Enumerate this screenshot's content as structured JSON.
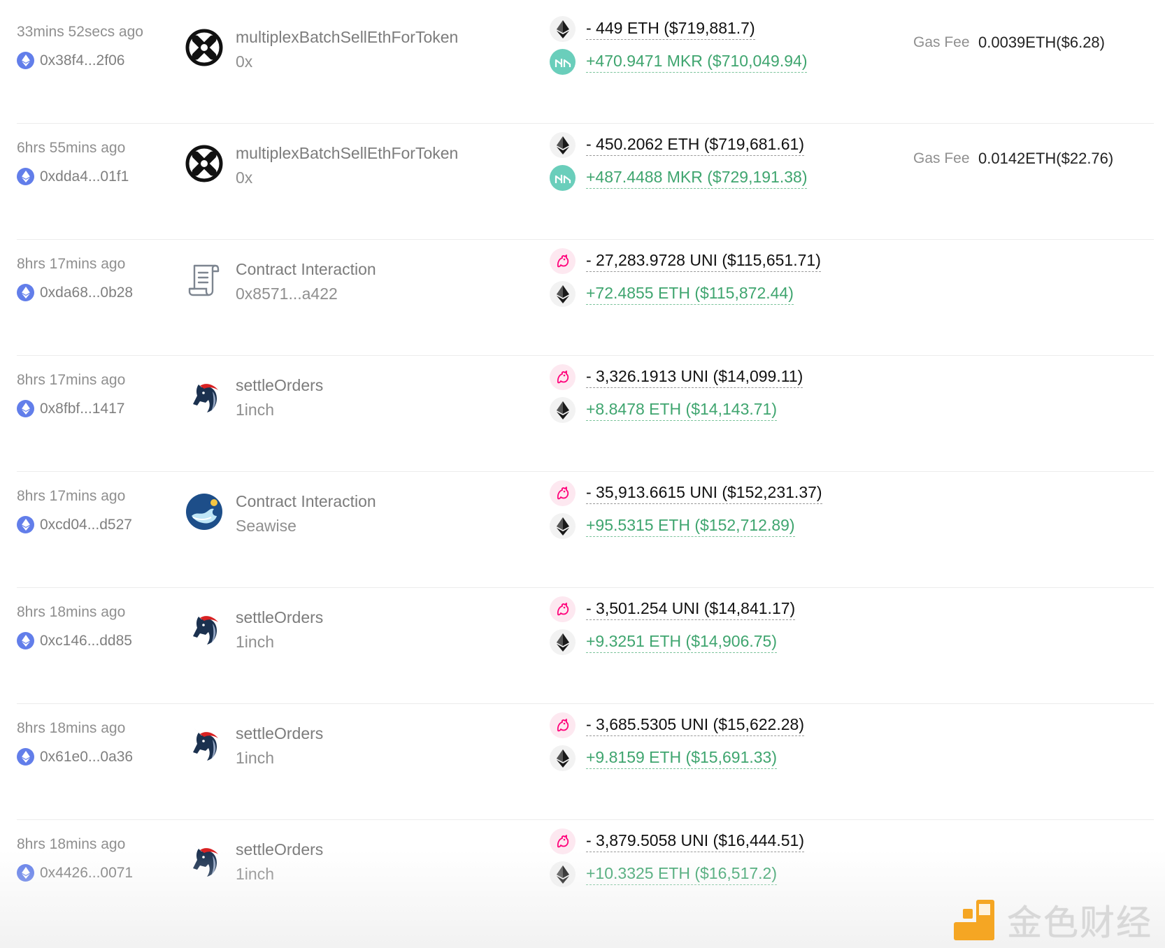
{
  "transactions": [
    {
      "time": "33mins 52secs ago",
      "address": "0x38f4...2f06",
      "app_icon": "0x-icon",
      "method": "multiplexBatchSellEthForToken",
      "app": "0x",
      "out": {
        "token_icon": "eth-icon",
        "text": "- 449 ETH ($719,881.7)"
      },
      "in": {
        "token_icon": "mkr-icon",
        "text": "+470.9471 MKR ($710,049.94)"
      },
      "gas_label": "Gas Fee",
      "gas_value": "0.0039ETH($6.28)"
    },
    {
      "time": "6hrs 55mins ago",
      "address": "0xdda4...01f1",
      "app_icon": "0x-icon",
      "method": "multiplexBatchSellEthForToken",
      "app": "0x",
      "out": {
        "token_icon": "eth-icon",
        "text": "- 450.2062 ETH ($719,681.61)"
      },
      "in": {
        "token_icon": "mkr-icon",
        "text": "+487.4488 MKR ($729,191.38)"
      },
      "gas_label": "Gas Fee",
      "gas_value": "0.0142ETH($22.76)"
    },
    {
      "time": "8hrs 17mins ago",
      "address": "0xda68...0b28",
      "app_icon": "contract-scroll-icon",
      "method": "Contract Interaction",
      "app": "0x8571...a422",
      "out": {
        "token_icon": "uni-icon",
        "text": "- 27,283.9728 UNI ($115,651.71)"
      },
      "in": {
        "token_icon": "eth-icon",
        "text": "+72.4855 ETH ($115,872.44)"
      }
    },
    {
      "time": "8hrs 17mins ago",
      "address": "0x8fbf...1417",
      "app_icon": "1inch-unicorn-icon",
      "method": "settleOrders",
      "app": "1inch",
      "out": {
        "token_icon": "uni-icon",
        "text": "- 3,326.1913 UNI ($14,099.11)"
      },
      "in": {
        "token_icon": "eth-icon",
        "text": "+8.8478 ETH ($14,143.71)"
      }
    },
    {
      "time": "8hrs 17mins ago",
      "address": "0xcd04...d527",
      "app_icon": "seawise-icon",
      "method": "Contract Interaction",
      "app": "Seawise",
      "out": {
        "token_icon": "uni-icon",
        "text": "- 35,913.6615 UNI ($152,231.37)"
      },
      "in": {
        "token_icon": "eth-icon",
        "text": "+95.5315 ETH ($152,712.89)"
      }
    },
    {
      "time": "8hrs 18mins ago",
      "address": "0xc146...dd85",
      "app_icon": "1inch-unicorn-icon",
      "method": "settleOrders",
      "app": "1inch",
      "out": {
        "token_icon": "uni-icon",
        "text": "- 3,501.254 UNI ($14,841.17)"
      },
      "in": {
        "token_icon": "eth-icon",
        "text": "+9.3251 ETH ($14,906.75)"
      }
    },
    {
      "time": "8hrs 18mins ago",
      "address": "0x61e0...0a36",
      "app_icon": "1inch-unicorn-icon",
      "method": "settleOrders",
      "app": "1inch",
      "out": {
        "token_icon": "uni-icon",
        "text": "- 3,685.5305 UNI ($15,622.28)"
      },
      "in": {
        "token_icon": "eth-icon",
        "text": "+9.8159 ETH ($15,691.33)"
      }
    },
    {
      "time": "8hrs 18mins ago",
      "address": "0x4426...0071",
      "app_icon": "1inch-unicorn-icon",
      "method": "settleOrders",
      "app": "1inch",
      "out": {
        "token_icon": "uni-icon",
        "text": "- 3,879.5058 UNI ($16,444.51)"
      },
      "in": {
        "token_icon": "eth-icon",
        "text": "+10.3325 ETH ($16,517.2)"
      }
    }
  ],
  "watermark": {
    "text": "金色财经"
  },
  "colors": {
    "positive": "#3fa56f",
    "negative": "#111111",
    "eth_wallet": "#627eea",
    "mkr": "#6acebb",
    "uni": "#ff007a",
    "watermark_logo": "#f5a623"
  }
}
